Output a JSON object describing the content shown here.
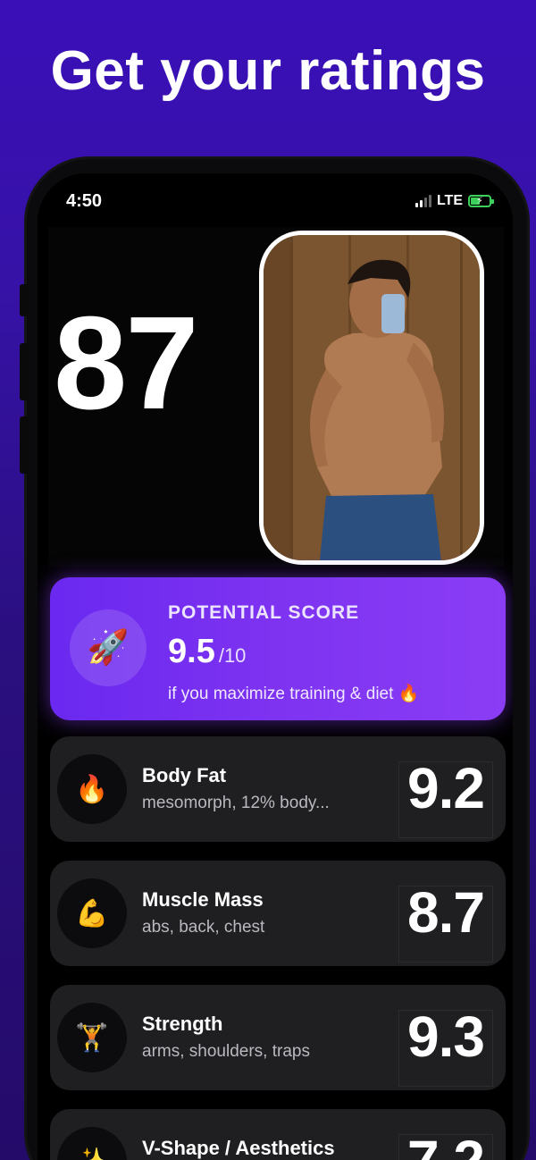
{
  "headline": "Get your ratings",
  "status_bar": {
    "time": "4:50",
    "network": "LTE"
  },
  "overall_score": "87",
  "potential": {
    "label": "POTENTIAL SCORE",
    "value": "9.5",
    "out_of": "/10",
    "subtitle": "if you maximize training & diet 🔥",
    "icon": "🚀"
  },
  "ratings": [
    {
      "icon": "🔥",
      "title": "Body Fat",
      "subtitle": "mesomorph, 12% body...",
      "score": "9.2"
    },
    {
      "icon": "💪",
      "title": "Muscle Mass",
      "subtitle": "abs, back, chest",
      "score": "8.7"
    },
    {
      "icon": "🏋️",
      "title": "Strength",
      "subtitle": "arms, shoulders, traps",
      "score": "9.3"
    },
    {
      "icon": "✨",
      "title": "V-Shape / Aesthetics",
      "subtitle": "",
      "score": "7.2"
    }
  ],
  "colors": {
    "background_top": "#3a0fb8",
    "potential_card": "#7c32f0",
    "row_card": "#1f1f22",
    "battery": "#3bd15a"
  }
}
